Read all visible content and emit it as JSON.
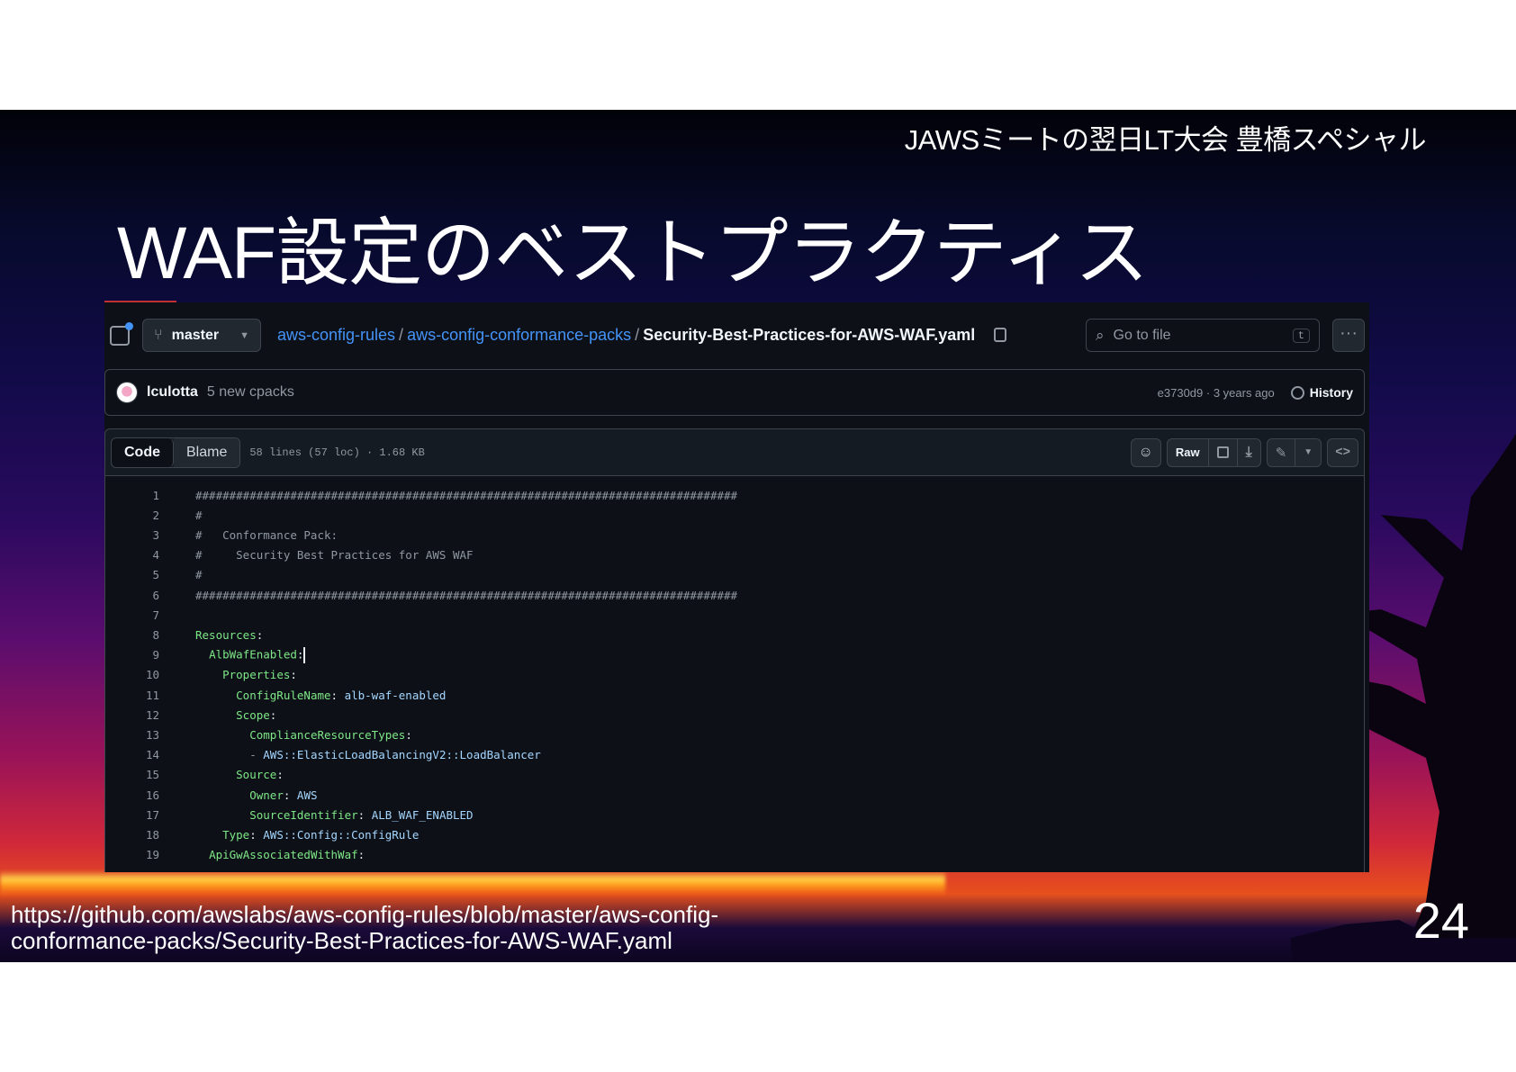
{
  "slide": {
    "event_title": "JAWSミートの翌日LT大会 豊橋スペシャル",
    "title": "WAF設定のベストプラクティス",
    "source_url_line1": "https://github.com/awslabs/aws-config-rules/blob/master/aws-config-",
    "source_url_line2": "conformance-packs/Security-Best-Practices-for-AWS-WAF.yaml",
    "page_number": "24"
  },
  "github": {
    "branch": "master",
    "breadcrumb": {
      "repo": "aws-config-rules",
      "folder": "aws-config-conformance-packs",
      "file": "Security-Best-Practices-for-AWS-WAF.yaml",
      "separator": "/"
    },
    "search": {
      "placeholder": "Go to file",
      "shortcut": "t"
    },
    "more_label": "···",
    "commit": {
      "author": "lculotta",
      "message": "5 new cpacks",
      "meta": "e3730d9 · 3 years ago",
      "history_label": "History"
    },
    "file_header": {
      "tab_code": "Code",
      "tab_blame": "Blame",
      "info": "58 lines (57 loc) · 1.68 KB",
      "raw_label": "Raw"
    },
    "code_lines": [
      {
        "n": "1",
        "indent": "",
        "key": "",
        "text": "################################################################################"
      },
      {
        "n": "2",
        "indent": "",
        "key": "",
        "text": "#"
      },
      {
        "n": "3",
        "indent": "",
        "key": "",
        "text": "#   Conformance Pack:"
      },
      {
        "n": "4",
        "indent": "",
        "key": "",
        "text": "#     Security Best Practices for AWS WAF"
      },
      {
        "n": "5",
        "indent": "",
        "key": "",
        "text": "#"
      },
      {
        "n": "6",
        "indent": "",
        "key": "",
        "text": "################################################################################"
      },
      {
        "n": "7",
        "indent": "",
        "key": "",
        "text": ""
      },
      {
        "n": "8",
        "indent": "",
        "key": "Resources",
        "text": ""
      },
      {
        "n": "9",
        "indent": "  ",
        "key": "AlbWafEnabled",
        "text": ""
      },
      {
        "n": "10",
        "indent": "    ",
        "key": "Properties",
        "text": ""
      },
      {
        "n": "11",
        "indent": "      ",
        "key": "ConfigRuleName",
        "text": "alb-waf-enabled"
      },
      {
        "n": "12",
        "indent": "      ",
        "key": "Scope",
        "text": ""
      },
      {
        "n": "13",
        "indent": "        ",
        "key": "ComplianceResourceTypes",
        "text": ""
      },
      {
        "n": "14",
        "indent": "        ",
        "key": "",
        "text": "- AWS::ElasticLoadBalancingV2::LoadBalancer"
      },
      {
        "n": "15",
        "indent": "      ",
        "key": "Source",
        "text": ""
      },
      {
        "n": "16",
        "indent": "        ",
        "key": "Owner",
        "text": "AWS"
      },
      {
        "n": "17",
        "indent": "        ",
        "key": "SourceIdentifier",
        "text": "ALB_WAF_ENABLED"
      },
      {
        "n": "18",
        "indent": "    ",
        "key": "Type",
        "text": "AWS::Config::ConfigRule"
      },
      {
        "n": "19",
        "indent": "  ",
        "key": "ApiGwAssociatedWithWaf",
        "text": ""
      }
    ]
  }
}
